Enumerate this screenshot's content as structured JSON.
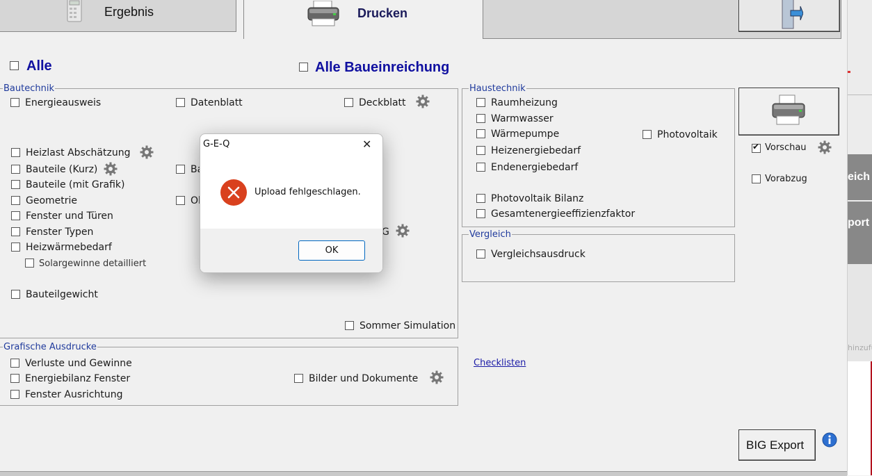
{
  "tabs": {
    "ergebnis": "Ergebnis",
    "drucken": "Drucken"
  },
  "select_all": {
    "alle": "Alle",
    "alle_baueinreichung": "Alle Baueinreichung"
  },
  "bautechnik": {
    "title": "Bautechnik",
    "energieausweis": "Energieausweis",
    "datenblatt": "Datenblatt",
    "deckblatt": "Deckblatt",
    "heizlast": "Heizlast Abschätzung",
    "bauteile_kurz": "Bauteile (Kurz)",
    "bauteile_kurz_right_partial": "Ba",
    "bauteile_grafik": "Bauteile (mit Grafik)",
    "geometrie": "Geometrie",
    "geometrie_right_partial": "Ol",
    "fenster_tueren": "Fenster und Türen",
    "fenster_typen": "Fenster Typen",
    "heizwaermebedarf": "Heizwärmebedarf",
    "solargewinne": "Solargewinne detailliert",
    "hidden_item_partial": "G",
    "bauteilgewicht": "Bauteilgewicht",
    "sommer": "Sommer Simulation"
  },
  "grafische": {
    "title": "Grafische Ausdrucke",
    "verluste": "Verluste und Gewinne",
    "energiebilanz": "Energiebilanz Fenster",
    "fenster_ausrichtung": "Fenster Ausrichtung",
    "bilder": "Bilder und Dokumente"
  },
  "haustechnik": {
    "title": "Haustechnik",
    "raumheizung": "Raumheizung",
    "warmwasser": "Warmwasser",
    "waermepumpe": "Wärmepumpe",
    "photovoltaik": "Photovoltaik",
    "heizenergiebedarf": "Heizenergiebedarf",
    "endenergiebedarf": "Endenergiebedarf",
    "pv_bilanz": "Photovoltaik Bilanz",
    "gesamtenergie": "Gesamtenergieeffizienzfaktor"
  },
  "vergleich": {
    "title": "Vergleich",
    "ausdruck": "Vergleichsausdruck"
  },
  "right_panel": {
    "vorschau": "Vorschau",
    "vorschau_checked": true,
    "vorabzug": "Vorabzug",
    "big_export": "BIG Export",
    "checklisten": "Checklisten"
  },
  "background_window": {
    "item1": "eich",
    "item2": "port",
    "item3": "hinzufü"
  },
  "dialog": {
    "title": "G-E-Q",
    "message": "Upload fehlgeschlagen.",
    "ok": "OK",
    "close_glyph": "✕"
  },
  "colors": {
    "accent_title": "#1010a0",
    "group_title": "#1f3a9c",
    "error_red": "#d9411e",
    "ok_border": "#0067c0"
  }
}
